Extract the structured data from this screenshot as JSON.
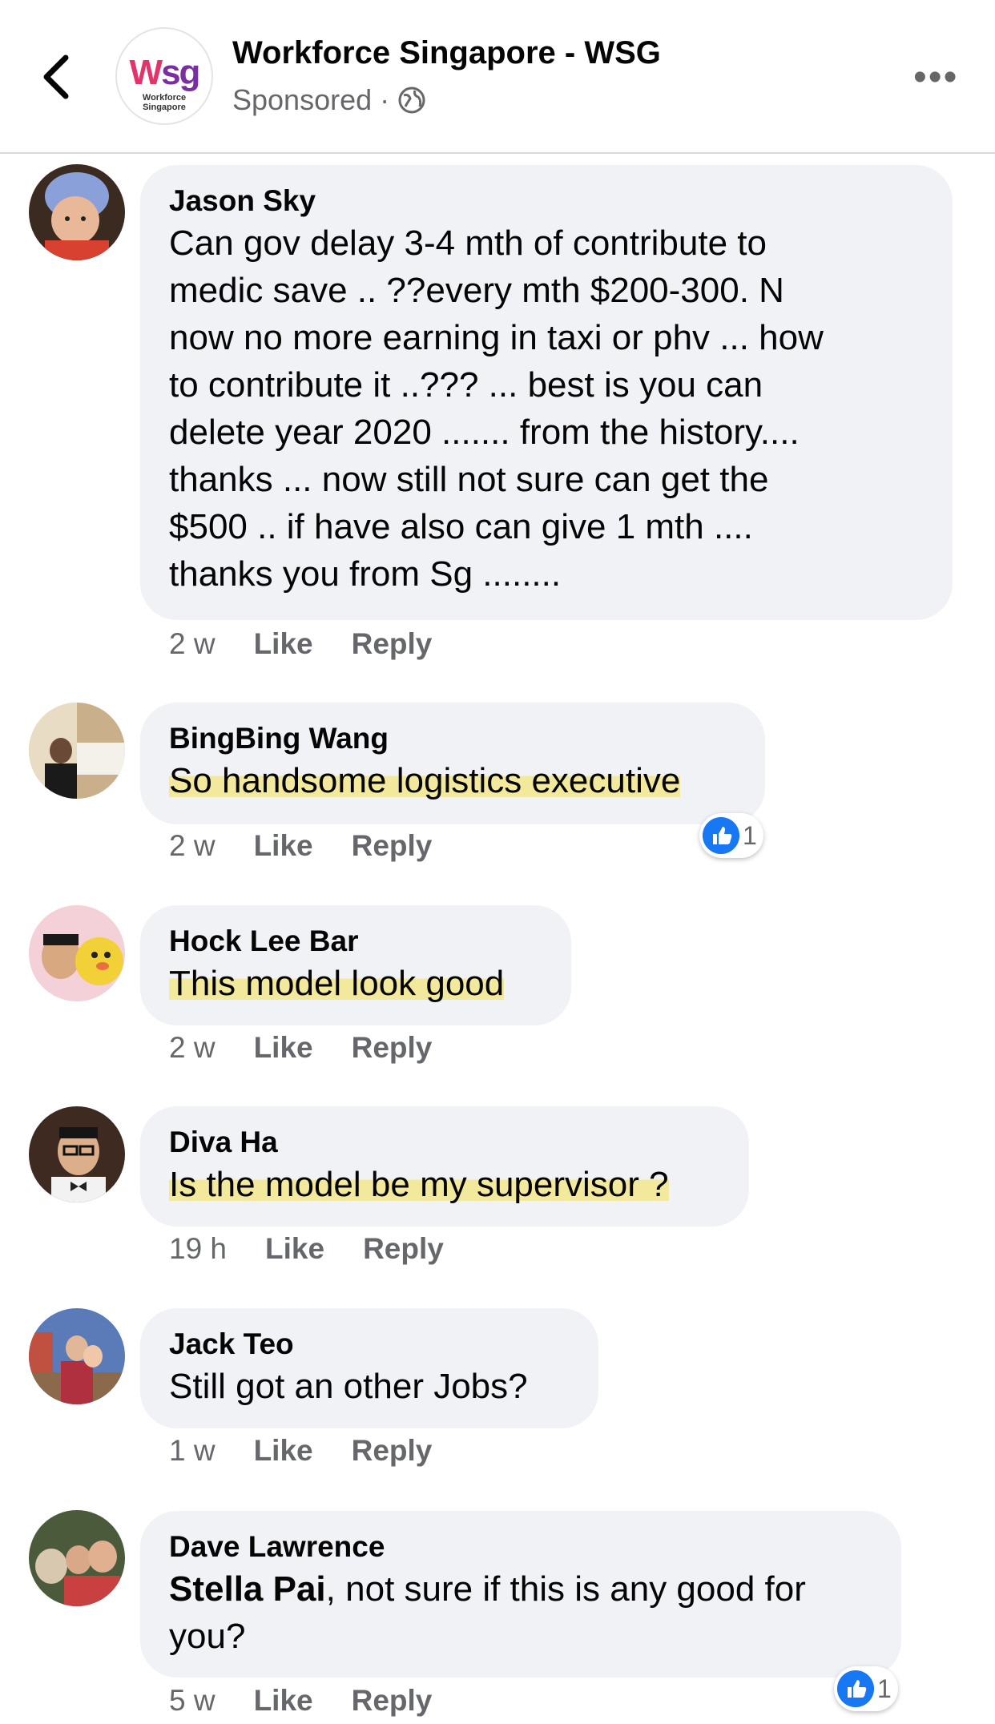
{
  "header": {
    "back_icon": "chevron-left-icon",
    "page_name": "Workforce Singapore - WSG",
    "sponsored": "Sponsored",
    "dot": "·",
    "privacy_icon": "globe-icon",
    "more": "•••",
    "logo": {
      "mark_w": "W",
      "mark_sg": "sg",
      "sub_line1": "Workforce",
      "sub_line2": "Singapore"
    }
  },
  "colors": {
    "brand_purple": "#7a2ea0",
    "brand_pink": "#e2336b",
    "like_blue": "#1877f2",
    "highlight": "#f5e46e"
  },
  "comments": [
    {
      "author": "Jason Sky",
      "lines": [
        "Can gov delay 3-4 mth of contribute to",
        "medic save  .. ??every mth $200-300. N",
        "now no more earning in taxi or phv ...    how",
        "to contribute it ..???    ... best is you can",
        "delete year 2020 ....... from the history....",
        "thanks ... now still not sure can get the",
        "$500  .. if have also can give 1 mth ....",
        "thanks you from Sg ........"
      ],
      "time": "2 w",
      "like": "Like",
      "reply": "Reply"
    },
    {
      "author": "BingBing Wang",
      "text": "So handsome logistics executive",
      "time": "2 w",
      "like": "Like",
      "reply": "Reply",
      "reaction_count": "1"
    },
    {
      "author": "Hock Lee Bar",
      "text": "This model look good",
      "time": "2 w",
      "like": "Like",
      "reply": "Reply"
    },
    {
      "author": "Diva Ha",
      "text": "Is the model be my supervisor ?",
      "time": "19 h",
      "like": "Like",
      "reply": "Reply"
    },
    {
      "author": "Jack Teo",
      "text": "Still got an other Jobs?",
      "time": "1 w",
      "like": "Like",
      "reply": "Reply"
    },
    {
      "author": "Dave Lawrence",
      "mention": "Stella Pai",
      "text_after_mention": ", not sure if this is any good for",
      "text_line2": "you?",
      "time": "5 w",
      "like": "Like",
      "reply": "Reply",
      "reaction_count": "1"
    }
  ]
}
